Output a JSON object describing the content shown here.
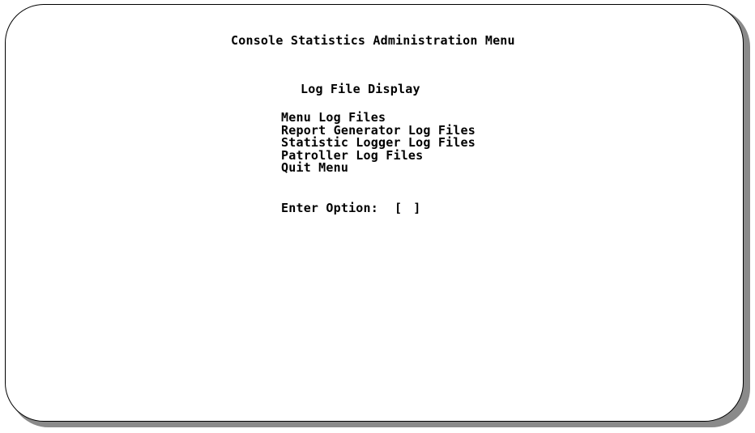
{
  "screen": {
    "title": "Console Statistics Administration Menu",
    "subtitle": "Log File Display",
    "menu_items": [
      "Menu Log Files",
      "Report Generator Log Files",
      "Statistic Logger Log Files",
      "Patroller Log Files",
      "Quit Menu"
    ],
    "prompt_label": "Enter Option:",
    "option_open_bracket": "[",
    "option_value": "",
    "option_close_bracket": "]"
  }
}
